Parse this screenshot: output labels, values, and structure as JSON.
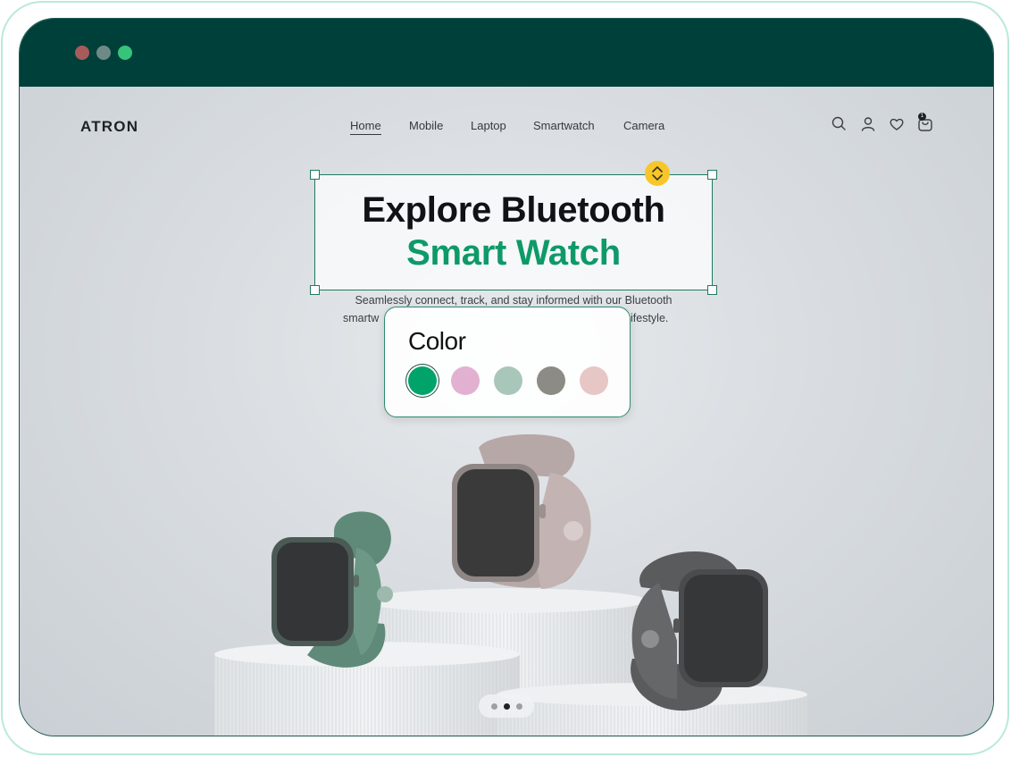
{
  "brand": {
    "logo": "ATRON"
  },
  "nav": {
    "items": [
      {
        "label": "Home",
        "active": true
      },
      {
        "label": "Mobile",
        "active": false
      },
      {
        "label": "Laptop",
        "active": false
      },
      {
        "label": "Smartwatch",
        "active": false
      },
      {
        "label": "Camera",
        "active": false
      }
    ],
    "icons": [
      "search-icon",
      "user-icon",
      "heart-icon",
      "cart-icon"
    ],
    "cart_count": "1"
  },
  "hero": {
    "headline_line1": "Explore Bluetooth",
    "headline_line2": "Smart Watch",
    "subtitle_line1": "Seamlessly connect, track, and stay informed with our Bluetooth",
    "subtitle_line2_start": "smartw",
    "subtitle_line2_end": "ifestyle."
  },
  "color_picker": {
    "title": "Color",
    "swatches": [
      {
        "name": "green",
        "hex": "#00a46a",
        "selected": true
      },
      {
        "name": "pink",
        "hex": "#e2b1d2",
        "selected": false
      },
      {
        "name": "sage",
        "hex": "#a9c6bb",
        "selected": false
      },
      {
        "name": "gray",
        "hex": "#8c8b85",
        "selected": false
      },
      {
        "name": "blush",
        "hex": "#e7c6c6",
        "selected": false
      }
    ]
  },
  "carousel": {
    "page_count": 3,
    "active_index": 1
  },
  "colors": {
    "titlebar": "#00403a",
    "accent_green": "#0e9a68",
    "handle_yellow": "#f7c629"
  }
}
